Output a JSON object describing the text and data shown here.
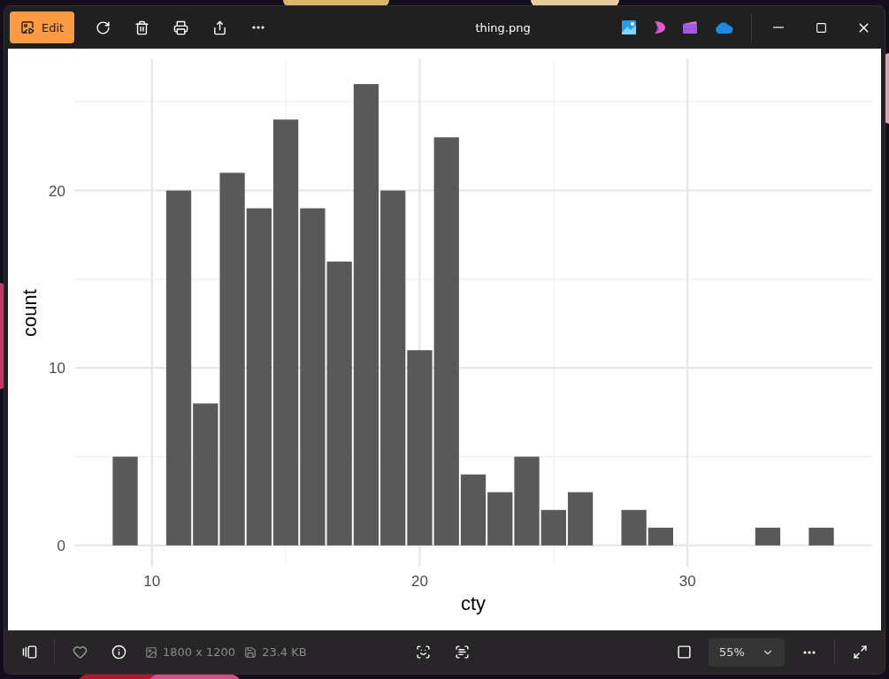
{
  "window": {
    "title": "thing.png"
  },
  "toolbar": {
    "edit_label": "Edit"
  },
  "image": {
    "chart_data": {
      "type": "bar",
      "xlabel": "cty",
      "ylabel": "count",
      "x": [
        9,
        10,
        11,
        12,
        13,
        14,
        15,
        16,
        17,
        18,
        19,
        20,
        21,
        22,
        23,
        24,
        25,
        26,
        27,
        28,
        29,
        30,
        31,
        32,
        33,
        34,
        35
      ],
      "values": [
        5,
        0,
        20,
        8,
        21,
        19,
        24,
        19,
        16,
        26,
        20,
        11,
        23,
        4,
        3,
        5,
        2,
        3,
        0,
        2,
        1,
        0,
        0,
        0,
        1,
        0,
        1
      ],
      "grid": true,
      "xlim": [
        7.1,
        36.9
      ],
      "ylim": [
        -1.2,
        27.4
      ],
      "xticks": [
        10,
        20,
        30
      ],
      "yticks": [
        0,
        10,
        20
      ]
    }
  },
  "status_bar": {
    "favorite": false,
    "dimensions": "1800 x 1200",
    "file_size": "23.4 KB",
    "zoom": "55%"
  }
}
